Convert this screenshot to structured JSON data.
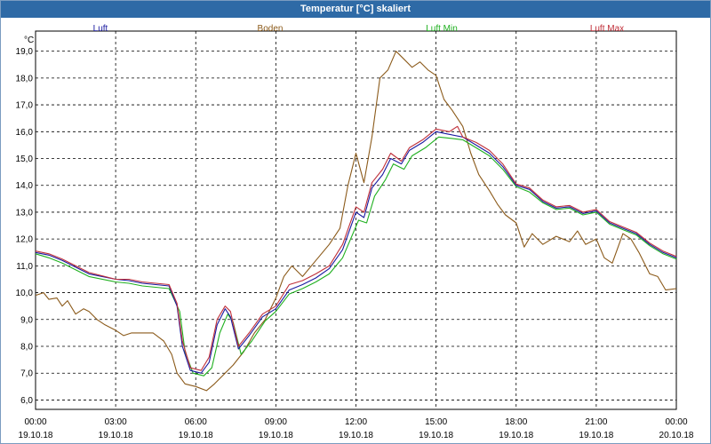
{
  "title": "Temperatur [°C] skaliert",
  "chart_data": {
    "type": "line",
    "title": "Temperatur [°C] skaliert",
    "ylabel": "°C",
    "ylim": [
      5.65,
      19.75
    ],
    "y_ticks": [
      "6,0",
      "7,0",
      "8,0",
      "9,0",
      "10,0",
      "11,0",
      "12,0",
      "13,0",
      "14,0",
      "15,0",
      "16,0",
      "17,0",
      "18,0",
      "19,0"
    ],
    "x_ticks": [
      {
        "time": "00:00",
        "date": "19.10.18"
      },
      {
        "time": "03:00",
        "date": "19.10.18"
      },
      {
        "time": "06:00",
        "date": "19.10.18"
      },
      {
        "time": "09:00",
        "date": "19.10.18"
      },
      {
        "time": "12:00",
        "date": "19.10.18"
      },
      {
        "time": "15:00",
        "date": "19.10.18"
      },
      {
        "time": "18:00",
        "date": "19.10.18"
      },
      {
        "time": "21:00",
        "date": "19.10.18"
      },
      {
        "time": "00:00",
        "date": "20.10.18"
      }
    ],
    "grid": true,
    "legend_position": "top",
    "series": [
      {
        "name": "Luft",
        "color": "#1a1aa0",
        "points": [
          [
            0,
            11.5
          ],
          [
            0.5,
            11.4
          ],
          [
            1,
            11.2
          ],
          [
            2,
            10.7
          ],
          [
            3,
            10.5
          ],
          [
            3.5,
            10.45
          ],
          [
            4,
            10.35
          ],
          [
            4.5,
            10.3
          ],
          [
            5,
            10.25
          ],
          [
            5.3,
            9.5
          ],
          [
            5.5,
            8.0
          ],
          [
            5.8,
            7.1
          ],
          [
            6.2,
            7.0
          ],
          [
            6.5,
            7.4
          ],
          [
            6.8,
            8.8
          ],
          [
            7.1,
            9.4
          ],
          [
            7.3,
            9.1
          ],
          [
            7.6,
            7.9
          ],
          [
            8,
            8.4
          ],
          [
            8.5,
            9.1
          ],
          [
            9,
            9.4
          ],
          [
            9.5,
            10.1
          ],
          [
            10,
            10.3
          ],
          [
            10.5,
            10.55
          ],
          [
            11,
            10.9
          ],
          [
            11.5,
            11.6
          ],
          [
            12,
            13.0
          ],
          [
            12.3,
            12.8
          ],
          [
            12.6,
            13.9
          ],
          [
            13,
            14.4
          ],
          [
            13.3,
            15.0
          ],
          [
            13.7,
            14.8
          ],
          [
            14,
            15.3
          ],
          [
            14.5,
            15.6
          ],
          [
            15,
            16.0
          ],
          [
            15.5,
            15.9
          ],
          [
            16,
            15.8
          ],
          [
            16.5,
            15.5
          ],
          [
            17,
            15.2
          ],
          [
            17.5,
            14.7
          ],
          [
            18,
            14.0
          ],
          [
            18.5,
            13.85
          ],
          [
            19,
            13.4
          ],
          [
            19.5,
            13.15
          ],
          [
            20,
            13.2
          ],
          [
            20.5,
            12.95
          ],
          [
            21,
            13.05
          ],
          [
            21.5,
            12.6
          ],
          [
            22,
            12.4
          ],
          [
            22.5,
            12.2
          ],
          [
            23,
            11.8
          ],
          [
            23.5,
            11.5
          ],
          [
            24,
            11.3
          ]
        ]
      },
      {
        "name": "Boden",
        "color": "#8b5a1a",
        "points": [
          [
            0,
            9.9
          ],
          [
            0.3,
            10.0
          ],
          [
            0.5,
            9.75
          ],
          [
            0.8,
            9.8
          ],
          [
            1,
            9.5
          ],
          [
            1.2,
            9.7
          ],
          [
            1.5,
            9.2
          ],
          [
            1.8,
            9.4
          ],
          [
            2,
            9.3
          ],
          [
            2.3,
            9.0
          ],
          [
            2.6,
            8.8
          ],
          [
            3,
            8.6
          ],
          [
            3.3,
            8.4
          ],
          [
            3.6,
            8.5
          ],
          [
            4,
            8.5
          ],
          [
            4.4,
            8.5
          ],
          [
            4.8,
            8.2
          ],
          [
            5.1,
            7.7
          ],
          [
            5.3,
            7.0
          ],
          [
            5.6,
            6.6
          ],
          [
            6,
            6.5
          ],
          [
            6.4,
            6.35
          ],
          [
            6.7,
            6.6
          ],
          [
            7,
            6.9
          ],
          [
            7.4,
            7.3
          ],
          [
            7.8,
            7.8
          ],
          [
            8.2,
            8.5
          ],
          [
            8.6,
            9.0
          ],
          [
            9,
            9.8
          ],
          [
            9.3,
            10.6
          ],
          [
            9.6,
            11.0
          ],
          [
            10,
            10.6
          ],
          [
            10.5,
            11.2
          ],
          [
            11,
            11.8
          ],
          [
            11.4,
            12.4
          ],
          [
            11.7,
            14.0
          ],
          [
            12,
            15.2
          ],
          [
            12.3,
            14.1
          ],
          [
            12.6,
            15.8
          ],
          [
            12.9,
            18.0
          ],
          [
            13.2,
            18.3
          ],
          [
            13.5,
            19.0
          ],
          [
            13.8,
            18.7
          ],
          [
            14.1,
            18.4
          ],
          [
            14.4,
            18.6
          ],
          [
            14.7,
            18.3
          ],
          [
            15,
            18.1
          ],
          [
            15.3,
            17.2
          ],
          [
            15.6,
            16.8
          ],
          [
            16,
            16.2
          ],
          [
            16.3,
            15.2
          ],
          [
            16.6,
            14.4
          ],
          [
            17,
            13.8
          ],
          [
            17.3,
            13.3
          ],
          [
            17.6,
            12.9
          ],
          [
            18,
            12.6
          ],
          [
            18.3,
            11.7
          ],
          [
            18.6,
            12.2
          ],
          [
            19,
            11.8
          ],
          [
            19.5,
            12.1
          ],
          [
            20,
            11.9
          ],
          [
            20.3,
            12.3
          ],
          [
            20.6,
            11.8
          ],
          [
            21,
            12.0
          ],
          [
            21.3,
            11.3
          ],
          [
            21.6,
            11.1
          ],
          [
            22,
            12.2
          ],
          [
            22.3,
            12.0
          ],
          [
            22.6,
            11.5
          ],
          [
            23,
            10.7
          ],
          [
            23.3,
            10.6
          ],
          [
            23.6,
            10.1
          ],
          [
            24,
            10.15
          ]
        ]
      },
      {
        "name": "Luft Min",
        "color": "#1fb01f",
        "points": [
          [
            0,
            11.45
          ],
          [
            0.5,
            11.3
          ],
          [
            1,
            11.1
          ],
          [
            2,
            10.6
          ],
          [
            3,
            10.4
          ],
          [
            3.5,
            10.35
          ],
          [
            4,
            10.25
          ],
          [
            4.5,
            10.2
          ],
          [
            5,
            10.15
          ],
          [
            5.4,
            9.3
          ],
          [
            5.6,
            7.8
          ],
          [
            5.9,
            7.0
          ],
          [
            6.3,
            6.9
          ],
          [
            6.6,
            7.2
          ],
          [
            6.9,
            8.5
          ],
          [
            7.2,
            9.2
          ],
          [
            7.4,
            8.9
          ],
          [
            7.7,
            7.7
          ],
          [
            8.1,
            8.2
          ],
          [
            8.6,
            8.95
          ],
          [
            9,
            9.3
          ],
          [
            9.5,
            9.95
          ],
          [
            10,
            10.15
          ],
          [
            10.5,
            10.4
          ],
          [
            11,
            10.7
          ],
          [
            11.5,
            11.3
          ],
          [
            12.1,
            12.7
          ],
          [
            12.4,
            12.6
          ],
          [
            12.7,
            13.6
          ],
          [
            13.1,
            14.2
          ],
          [
            13.4,
            14.8
          ],
          [
            13.8,
            14.6
          ],
          [
            14.1,
            15.1
          ],
          [
            14.6,
            15.4
          ],
          [
            15.1,
            15.8
          ],
          [
            15.6,
            15.75
          ],
          [
            16,
            15.7
          ],
          [
            16.5,
            15.4
          ],
          [
            17,
            15.1
          ],
          [
            17.5,
            14.6
          ],
          [
            18,
            13.95
          ],
          [
            18.5,
            13.75
          ],
          [
            19,
            13.35
          ],
          [
            19.5,
            13.1
          ],
          [
            20,
            13.15
          ],
          [
            20.5,
            12.9
          ],
          [
            21,
            13.0
          ],
          [
            21.5,
            12.55
          ],
          [
            22,
            12.35
          ],
          [
            22.5,
            12.15
          ],
          [
            23,
            11.75
          ],
          [
            23.5,
            11.45
          ],
          [
            24,
            11.25
          ]
        ]
      },
      {
        "name": "Luft Max",
        "color": "#c0303a",
        "points": [
          [
            0,
            11.55
          ],
          [
            0.5,
            11.45
          ],
          [
            1,
            11.25
          ],
          [
            2,
            10.75
          ],
          [
            3,
            10.5
          ],
          [
            3.5,
            10.5
          ],
          [
            4,
            10.4
          ],
          [
            4.5,
            10.35
          ],
          [
            5,
            10.3
          ],
          [
            5.3,
            9.6
          ],
          [
            5.5,
            8.2
          ],
          [
            5.8,
            7.2
          ],
          [
            6.2,
            7.1
          ],
          [
            6.5,
            7.6
          ],
          [
            6.8,
            9.0
          ],
          [
            7.1,
            9.5
          ],
          [
            7.3,
            9.3
          ],
          [
            7.6,
            8.0
          ],
          [
            8,
            8.5
          ],
          [
            8.5,
            9.2
          ],
          [
            9,
            9.5
          ],
          [
            9.5,
            10.3
          ],
          [
            10,
            10.45
          ],
          [
            10.5,
            10.7
          ],
          [
            11,
            11.0
          ],
          [
            11.5,
            11.8
          ],
          [
            12,
            13.2
          ],
          [
            12.3,
            13.0
          ],
          [
            12.6,
            14.1
          ],
          [
            13,
            14.6
          ],
          [
            13.3,
            15.2
          ],
          [
            13.7,
            14.9
          ],
          [
            14,
            15.4
          ],
          [
            14.5,
            15.7
          ],
          [
            15,
            16.1
          ],
          [
            15.5,
            16.0
          ],
          [
            15.8,
            16.2
          ],
          [
            16,
            15.8
          ],
          [
            16.5,
            15.6
          ],
          [
            17,
            15.3
          ],
          [
            17.5,
            14.8
          ],
          [
            18,
            14.05
          ],
          [
            18.5,
            13.9
          ],
          [
            19,
            13.45
          ],
          [
            19.5,
            13.2
          ],
          [
            20,
            13.25
          ],
          [
            20.5,
            13.0
          ],
          [
            21,
            13.1
          ],
          [
            21.5,
            12.65
          ],
          [
            22,
            12.45
          ],
          [
            22.5,
            12.25
          ],
          [
            23,
            11.85
          ],
          [
            23.5,
            11.55
          ],
          [
            24,
            11.35
          ]
        ]
      }
    ]
  }
}
